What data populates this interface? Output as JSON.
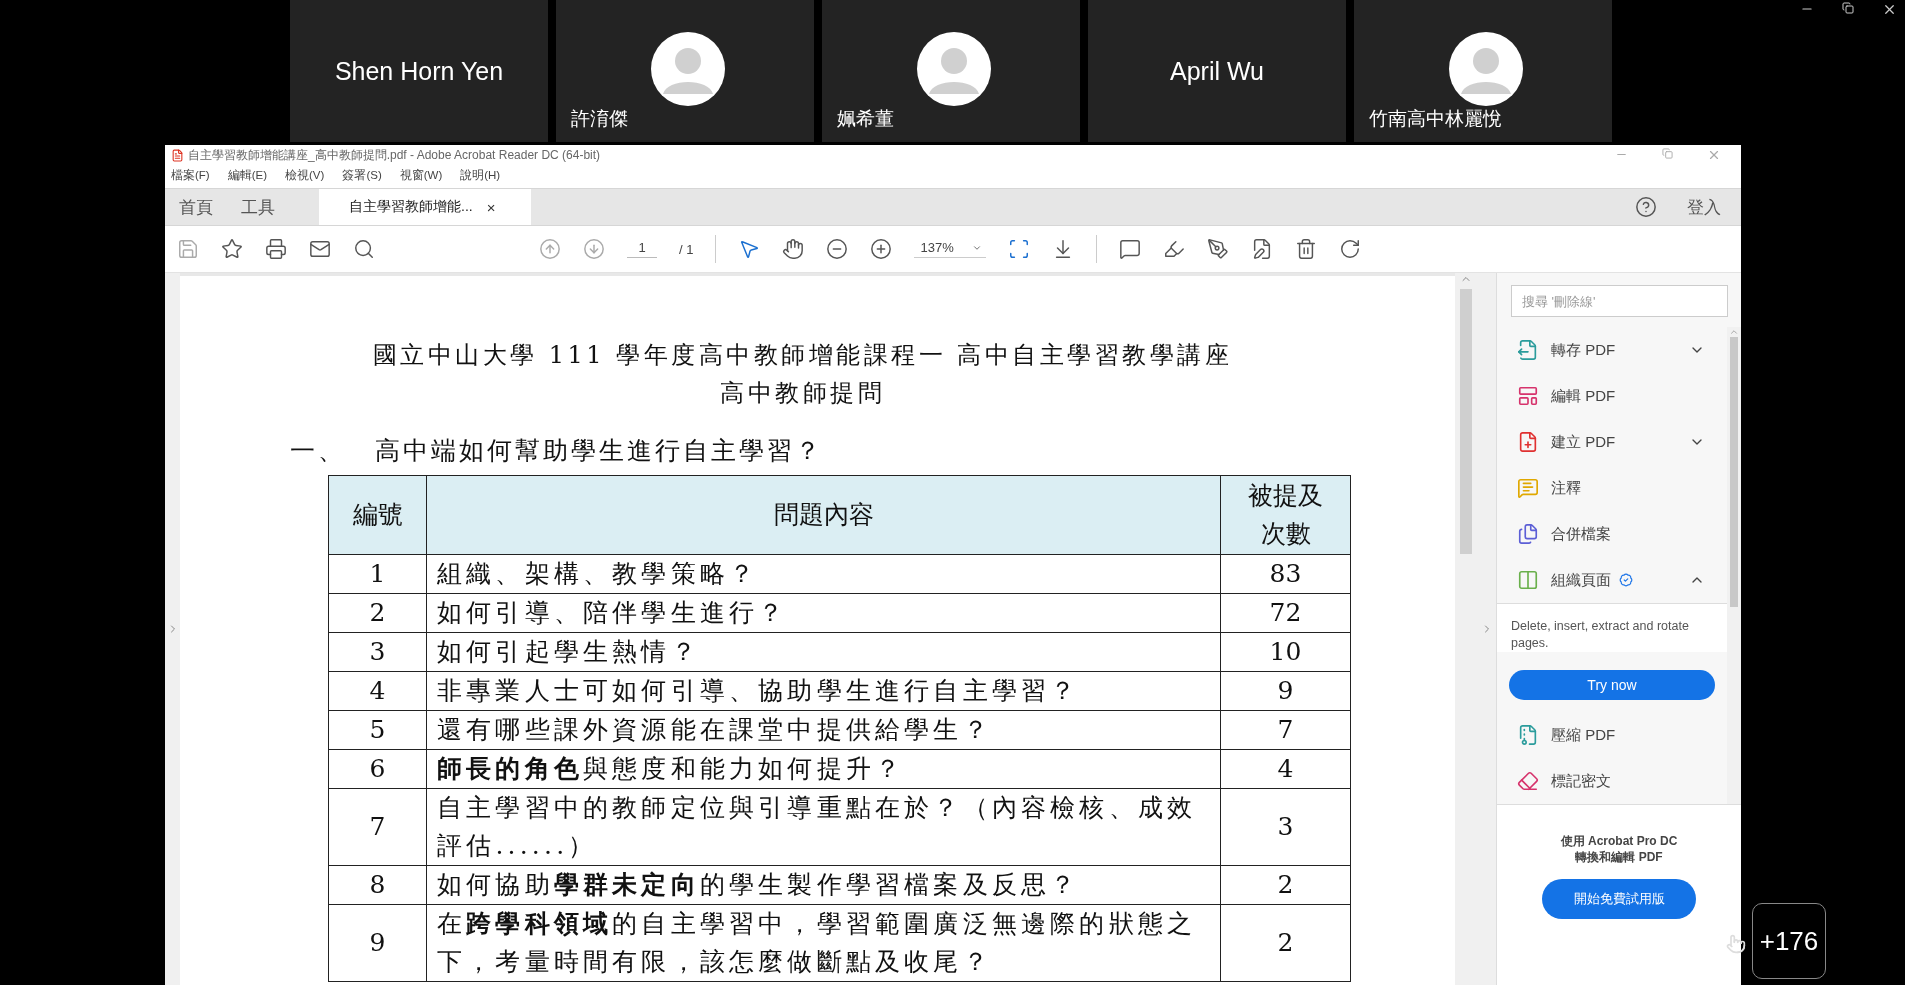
{
  "meeting": {
    "participants": [
      {
        "kind": "name",
        "name": "Shen Horn Yen"
      },
      {
        "kind": "avatar",
        "name": "許淯傑"
      },
      {
        "kind": "avatar",
        "name": "姵希董"
      },
      {
        "kind": "name",
        "name": "April Wu"
      },
      {
        "kind": "avatar",
        "name": "竹南高中林麗悅"
      }
    ],
    "more_count": "+176"
  },
  "window": {
    "title": "自主學習教師增能講座_高中教師提問.pdf - Adobe Acrobat Reader DC (64-bit)",
    "menu": [
      "檔案(F)",
      "編輯(E)",
      "檢視(V)",
      "簽署(S)",
      "視窗(W)",
      "說明(H)"
    ]
  },
  "tabs": [
    {
      "label": "首頁",
      "selected": false
    },
    {
      "label": "工具",
      "selected": false
    },
    {
      "label": "自主學習教師增能...",
      "selected": true,
      "close": "×"
    }
  ],
  "sign_in": "登入",
  "toolbar": {
    "page": "1",
    "page_total": "/ 1",
    "zoom": "137%"
  },
  "document": {
    "title": [
      "國立中山大學 111 學年度高中教師增能課程一 高中自主學習教學講座",
      "高中教師提問"
    ],
    "section": {
      "number": "一、",
      "text": "高中端如何幫助學生進行自主學習？"
    },
    "table": {
      "columns": [
        "編號",
        "問題內容",
        "被提及次數"
      ],
      "rows": [
        {
          "no": "1",
          "question": "組織、架構、教學策略？",
          "count": "83"
        },
        {
          "no": "2",
          "question": "如何引導、陪伴學生進行？",
          "count": "72"
        },
        {
          "no": "3",
          "question": "如何引起學生熱情？",
          "count": "10"
        },
        {
          "no": "4",
          "question": "非專業人士可如何引導、協助學生進行自主學習？",
          "count": "9"
        },
        {
          "no": "5",
          "question": "還有哪些課外資源能在課堂中提供給學生？",
          "count": "7"
        },
        {
          "no": "6",
          "question": "**師長的角色**與態度和能力如何提升？",
          "count": "4"
        },
        {
          "no": "7",
          "question": "自主學習中的教師定位與引導重點在於？（內容檢核、成效評估......）",
          "count": "3"
        },
        {
          "no": "8",
          "question": "如何協助**學群未定向**的學生製作學習檔案及反思？",
          "count": "2"
        },
        {
          "no": "9",
          "question": "在**跨學科領域**的自主學習中，學習範圍廣泛無邊際的狀態之下，考量時間有限，該怎麼做斷點及收尾？",
          "count": "2"
        }
      ]
    }
  },
  "tools_panel": {
    "search": {
      "placeholder": "搜尋 '刪除線'"
    },
    "items": [
      {
        "kind": "export",
        "label": "轉存 PDF",
        "expanded": false
      },
      {
        "kind": "edit",
        "label": "編輯 PDF"
      },
      {
        "kind": "create",
        "label": "建立 PDF",
        "expanded": false
      },
      {
        "kind": "comment",
        "label": "注釋"
      },
      {
        "kind": "combine",
        "label": "合併檔案"
      },
      {
        "kind": "organize",
        "label": "組織頁面",
        "expanded": true,
        "badge": true,
        "description": "Delete, insert, extract and rotate pages.",
        "action": "Try now"
      },
      {
        "kind": "compress",
        "label": "壓縮 PDF"
      },
      {
        "kind": "redact",
        "label": "標記密文"
      }
    ],
    "promo": {
      "lines": [
        "使用 Acrobat Pro DC",
        "轉換和編輯 PDF"
      ],
      "button": "開始免費試用版"
    }
  }
}
